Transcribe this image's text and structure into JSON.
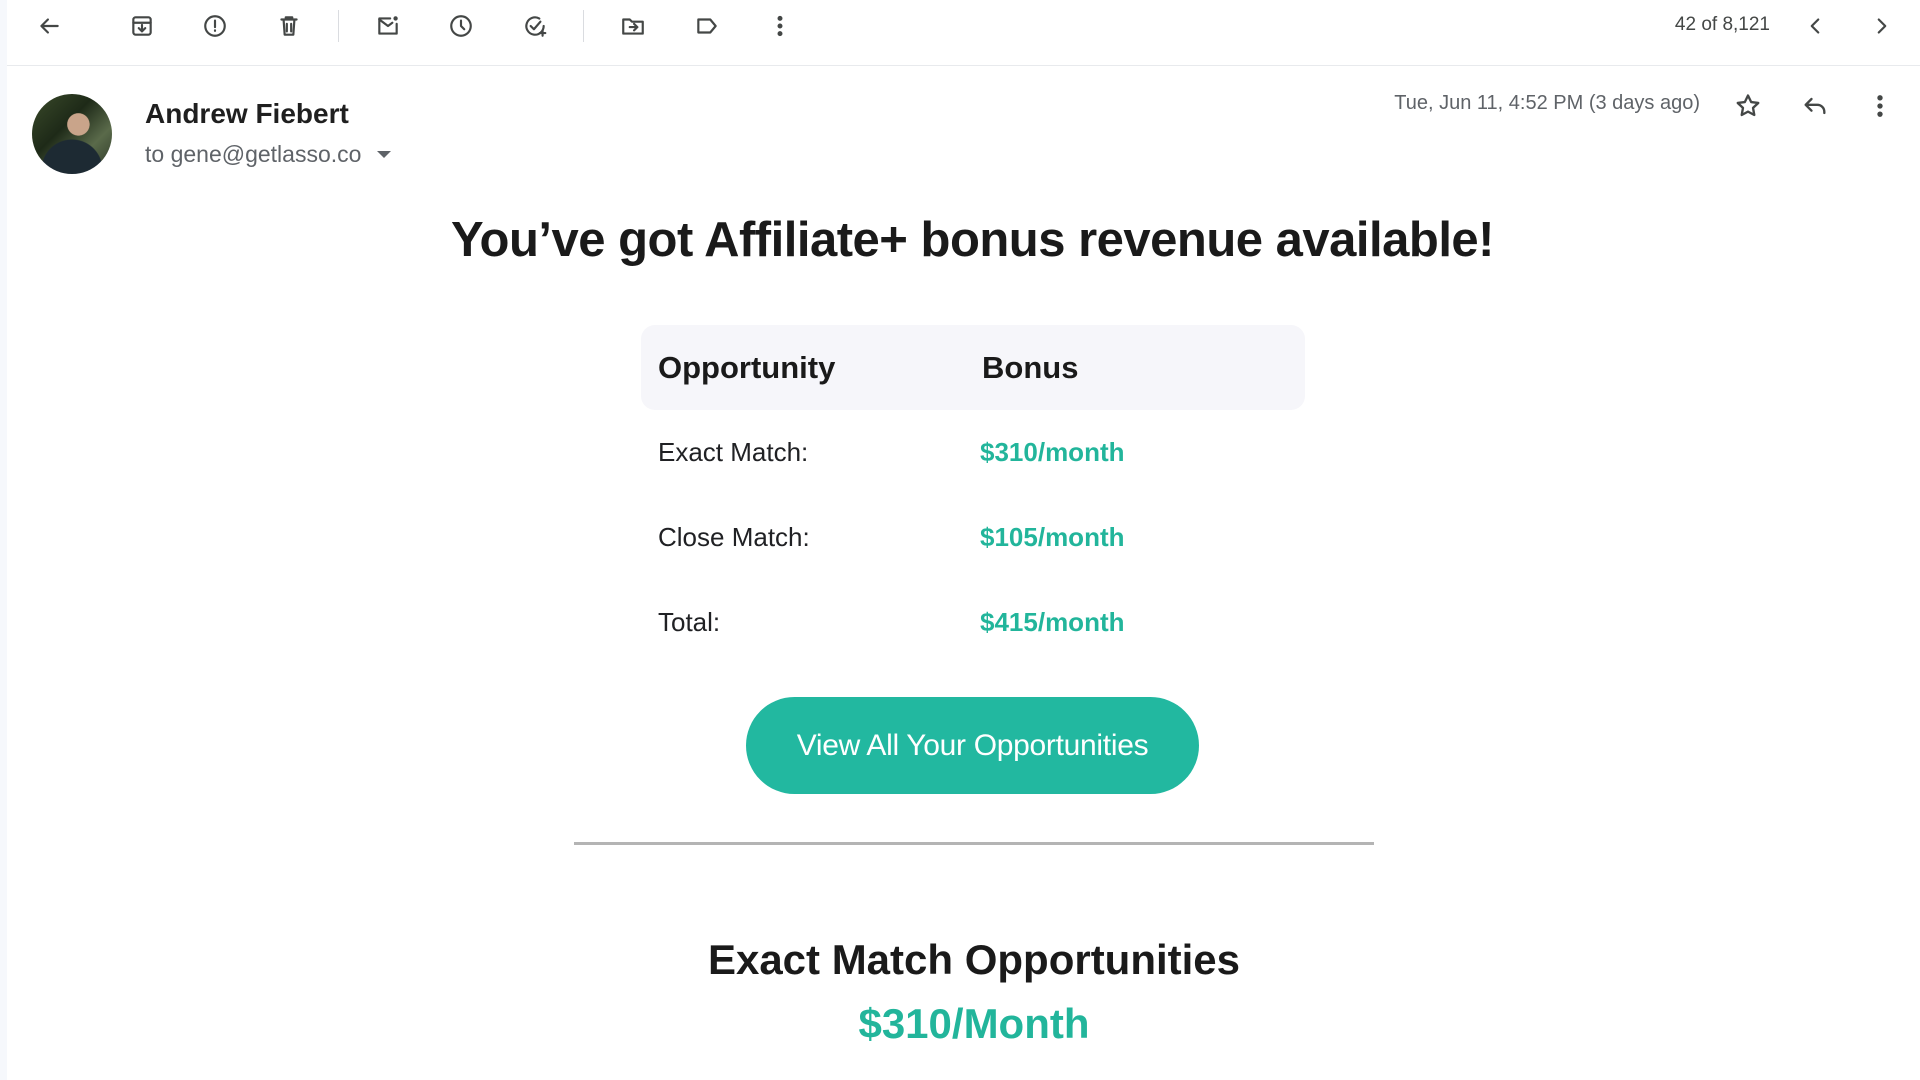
{
  "toolbar": {
    "counter": "42 of 8,121"
  },
  "email": {
    "sender_name": "Andrew Fiebert",
    "recipient": "to gene@getlasso.co",
    "date": "Tue, Jun 11, 4:52 PM (3 days ago)"
  },
  "body": {
    "headline": "You’ve got Affiliate+ bonus revenue available!",
    "table": {
      "headers": [
        "Opportunity",
        "Bonus"
      ],
      "rows": [
        {
          "label": "Exact Match:",
          "value": "$310/month"
        },
        {
          "label": "Close Match:",
          "value": "$105/month"
        },
        {
          "label": "Total:",
          "value": "$415/month"
        }
      ]
    },
    "cta_label": "View All Your Opportunities",
    "section_title": "Exact Match Opportunities",
    "section_value": "$310/Month"
  },
  "icons": [
    "back-arrow-icon",
    "archive-icon",
    "report-spam-icon",
    "delete-icon",
    "mark-unread-icon",
    "snooze-icon",
    "add-task-icon",
    "move-to-icon",
    "label-icon",
    "more-vert-icon",
    "prev-icon",
    "next-icon",
    "star-icon",
    "reply-icon"
  ],
  "colors": {
    "accent": "#22b8a0",
    "accent_text": "#22b59b",
    "table_header_bg": "#f6f6fa"
  }
}
